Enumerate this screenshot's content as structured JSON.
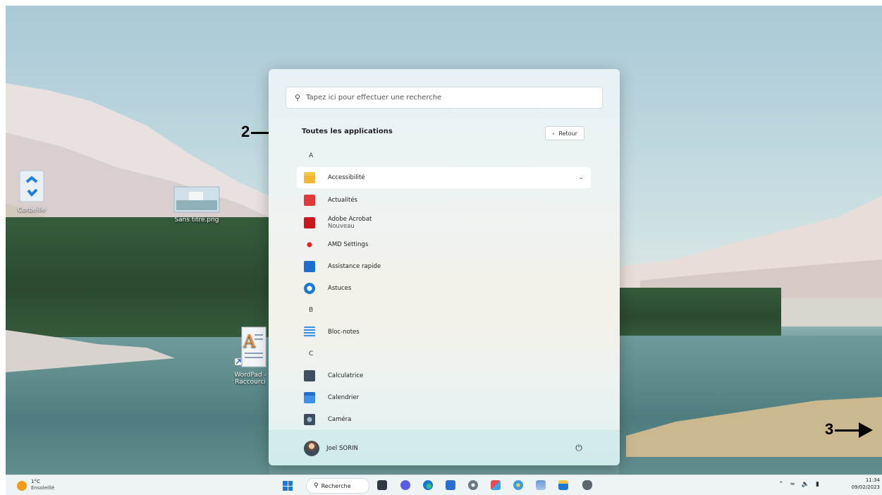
{
  "desktop": {
    "icons": [
      {
        "label": "Corbeille"
      },
      {
        "label": "Sans titre.png"
      },
      {
        "label": "WordPad - Raccourci"
      }
    ]
  },
  "annotations": {
    "arrow_2": "2",
    "arrow_3": "3"
  },
  "start_menu": {
    "search_placeholder": "Tapez ici pour effectuer une recherche",
    "title": "Toutes les applications",
    "back_label": "Retour",
    "sections": [
      {
        "letter": "A",
        "apps": [
          {
            "name": "Accessibilité",
            "icon": "folder-icon"
          },
          {
            "name": "Actualités",
            "icon": "news-icon"
          },
          {
            "name": "Adobe Acrobat",
            "subtitle": "Nouveau",
            "icon": "acrobat-icon"
          },
          {
            "name": "AMD Settings",
            "icon": "amd-icon"
          },
          {
            "name": "Assistance rapide",
            "icon": "quick-assist-icon"
          },
          {
            "name": "Astuces",
            "icon": "tips-icon"
          }
        ]
      },
      {
        "letter": "B",
        "apps": [
          {
            "name": "Bloc-notes",
            "icon": "notepad-icon"
          }
        ]
      },
      {
        "letter": "C",
        "apps": [
          {
            "name": "Calculatrice",
            "icon": "calculator-icon"
          },
          {
            "name": "Calendrier",
            "icon": "calendar-icon"
          },
          {
            "name": "Caméra",
            "icon": "camera-icon"
          }
        ]
      }
    ],
    "user_name": "Joel SORIN"
  },
  "taskbar": {
    "weather_temp": "1°C",
    "weather_desc": "Ensoleillé",
    "search_label": "Recherche",
    "time": "11:34",
    "date": "09/02/2023"
  },
  "colors": {
    "accent": "#1c7ad6",
    "weather_sun": "#f39c1a"
  }
}
